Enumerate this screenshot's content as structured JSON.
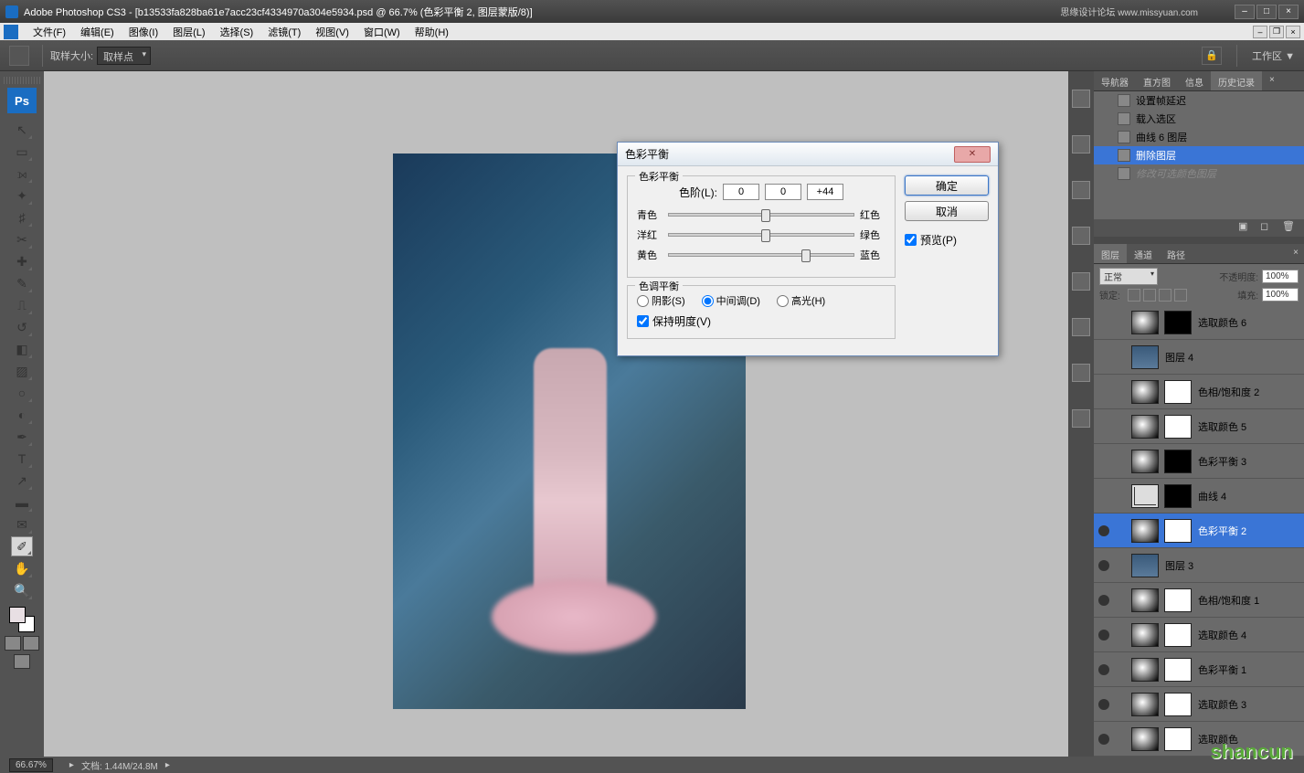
{
  "titlebar": {
    "app": "Adobe Photoshop CS3",
    "doc": "[b13533fa828ba61e7acc23cf4334970a304e5934.psd @ 66.7% (色彩平衡 2, 图层蒙版/8)]",
    "watermark": "思缘设计论坛 www.missyuan.com"
  },
  "menu": {
    "items": [
      "文件(F)",
      "编辑(E)",
      "图像(I)",
      "图层(L)",
      "选择(S)",
      "滤镜(T)",
      "视图(V)",
      "窗口(W)",
      "帮助(H)"
    ]
  },
  "optbar": {
    "sample_label": "取样大小:",
    "sample_value": "取样点",
    "workspace_label": "工作区 ▼"
  },
  "toolbox": {
    "ps": "Ps"
  },
  "dialog": {
    "title": "色彩平衡",
    "group1": "色彩平衡",
    "levels_label": "色阶(L):",
    "levels": [
      "0",
      "0",
      "+44"
    ],
    "sliders": [
      {
        "left": "青色",
        "right": "红色",
        "pos": 50
      },
      {
        "left": "洋红",
        "right": "绿色",
        "pos": 50
      },
      {
        "left": "黄色",
        "right": "蓝色",
        "pos": 72
      }
    ],
    "group2": "色调平衡",
    "tones": {
      "shadow": "阴影(S)",
      "mid": "中间调(D)",
      "high": "高光(H)"
    },
    "preserve": "保持明度(V)",
    "ok": "确定",
    "cancel": "取消",
    "preview": "预览(P)"
  },
  "history": {
    "tabs": [
      "导航器",
      "直方图",
      "信息",
      "历史记录"
    ],
    "items": [
      {
        "label": "设置帧延迟"
      },
      {
        "label": "载入选区"
      },
      {
        "label": "曲线 6 图层"
      },
      {
        "label": "删除图层",
        "selected": true
      },
      {
        "label": "修改可选颜色图层",
        "dim": true
      }
    ]
  },
  "layers": {
    "tabs": [
      "图层",
      "通道",
      "路径"
    ],
    "blend_label": "正常",
    "opacity_label": "不透明度:",
    "opacity_value": "100%",
    "lock_label": "锁定:",
    "fill_label": "填充:",
    "fill_value": "100%",
    "items": [
      {
        "name": "选取颜色 6",
        "vis": false,
        "type": "adj",
        "mask": "black"
      },
      {
        "name": "图层 4",
        "vis": false,
        "type": "img"
      },
      {
        "name": "色相/饱和度 2",
        "vis": false,
        "type": "adj",
        "mask": "white"
      },
      {
        "name": "选取颜色 5",
        "vis": false,
        "type": "adj",
        "mask": "white"
      },
      {
        "name": "色彩平衡 3",
        "vis": false,
        "type": "adj",
        "mask": "black"
      },
      {
        "name": "曲线 4",
        "vis": false,
        "type": "curve",
        "mask": "black"
      },
      {
        "name": "色彩平衡 2",
        "vis": true,
        "type": "adj",
        "mask": "gray",
        "selected": true
      },
      {
        "name": "图层 3",
        "vis": true,
        "type": "img"
      },
      {
        "name": "色相/饱和度 1",
        "vis": true,
        "type": "adj",
        "mask": "white"
      },
      {
        "name": "选取颜色 4",
        "vis": true,
        "type": "adj",
        "mask": "white"
      },
      {
        "name": "色彩平衡 1",
        "vis": true,
        "type": "adj",
        "mask": "white"
      },
      {
        "name": "选取颜色 3",
        "vis": true,
        "type": "adj",
        "mask": "white"
      },
      {
        "name": "选取颜色",
        "vis": true,
        "type": "adj",
        "mask": "white"
      }
    ]
  },
  "status": {
    "zoom": "66.67%",
    "doc": "文档: 1.44M/24.8M"
  },
  "logo": "shancun"
}
